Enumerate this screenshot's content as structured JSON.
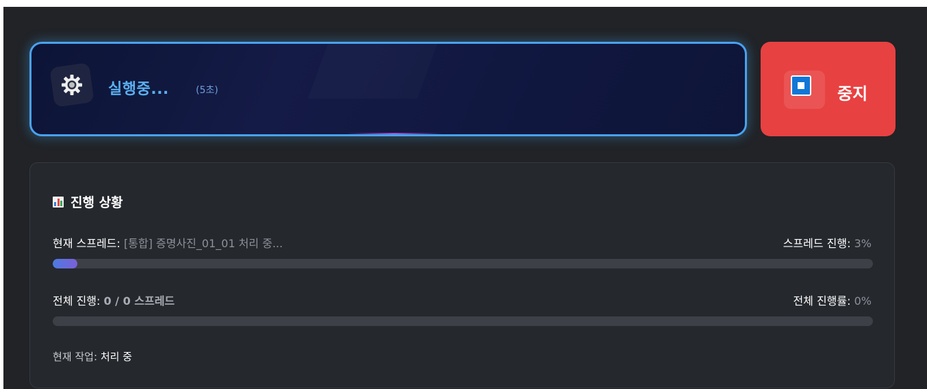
{
  "status": {
    "label": "실행중...",
    "elapsed": "(5초)",
    "icon": "gear-icon"
  },
  "stop_button": {
    "label": "중지",
    "icon": "stop-icon",
    "color": "#e84141"
  },
  "progress": {
    "title": "진행 상황",
    "title_icon": "bar-chart-icon",
    "current_spread": {
      "label": "현재 스프레드:",
      "value": "[통합] 증명사진_01_01 처리 중..."
    },
    "spread_progress": {
      "label": "스프레드 진행:",
      "value": "3%",
      "percent": 3
    },
    "overall": {
      "label": "전체 진행:",
      "value": "0 / 0 스프레드"
    },
    "overall_rate": {
      "label": "전체 진행률:",
      "value": "0%",
      "percent": 0
    },
    "current_task": {
      "label": "현재 작업:",
      "value": "처리 중"
    }
  },
  "colors": {
    "accent": "#4aa2ef",
    "stop": "#e84141",
    "progress_fill_start": "#4c7be0",
    "progress_fill_end": "#7c5fd8",
    "background": "#212327"
  }
}
